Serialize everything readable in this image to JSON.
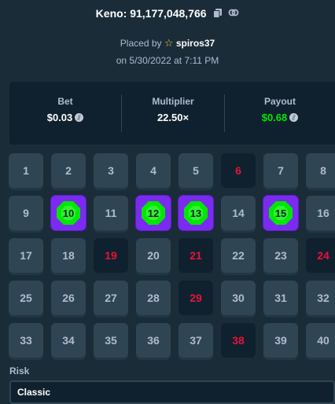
{
  "header": {
    "title": "Keno: 91,177,048,766",
    "placed_prefix": "Placed by",
    "username": "spiros37",
    "date": "on 5/30/2022 at 7:11 PM"
  },
  "stats": {
    "bet_label": "Bet",
    "bet_value": "$0.03",
    "multiplier_label": "Multiplier",
    "multiplier_value": "22.50×",
    "payout_label": "Payout",
    "payout_value": "$0.68"
  },
  "colors": {
    "background": "#1a2c38",
    "panel": "#0f212e",
    "tile": "#2f4553",
    "miss_text": "#e9113c",
    "hit_border": "#7b2bf0",
    "gem": "#00e701",
    "payout": "#00e701"
  },
  "tiles": [
    {
      "n": "1",
      "state": "normal"
    },
    {
      "n": "2",
      "state": "normal"
    },
    {
      "n": "3",
      "state": "normal"
    },
    {
      "n": "4",
      "state": "normal"
    },
    {
      "n": "5",
      "state": "normal"
    },
    {
      "n": "6",
      "state": "miss"
    },
    {
      "n": "7",
      "state": "normal"
    },
    {
      "n": "8",
      "state": "normal"
    },
    {
      "n": "9",
      "state": "normal"
    },
    {
      "n": "10",
      "state": "hit"
    },
    {
      "n": "11",
      "state": "normal"
    },
    {
      "n": "12",
      "state": "hit"
    },
    {
      "n": "13",
      "state": "hit"
    },
    {
      "n": "14",
      "state": "normal"
    },
    {
      "n": "15",
      "state": "hit"
    },
    {
      "n": "16",
      "state": "normal"
    },
    {
      "n": "17",
      "state": "normal"
    },
    {
      "n": "18",
      "state": "normal"
    },
    {
      "n": "19",
      "state": "miss"
    },
    {
      "n": "20",
      "state": "normal"
    },
    {
      "n": "21",
      "state": "miss"
    },
    {
      "n": "22",
      "state": "normal"
    },
    {
      "n": "23",
      "state": "normal"
    },
    {
      "n": "24",
      "state": "miss"
    },
    {
      "n": "25",
      "state": "normal"
    },
    {
      "n": "26",
      "state": "normal"
    },
    {
      "n": "27",
      "state": "normal"
    },
    {
      "n": "28",
      "state": "normal"
    },
    {
      "n": "29",
      "state": "miss"
    },
    {
      "n": "30",
      "state": "normal"
    },
    {
      "n": "31",
      "state": "normal"
    },
    {
      "n": "32",
      "state": "normal"
    },
    {
      "n": "33",
      "state": "normal"
    },
    {
      "n": "34",
      "state": "normal"
    },
    {
      "n": "35",
      "state": "normal"
    },
    {
      "n": "36",
      "state": "normal"
    },
    {
      "n": "37",
      "state": "normal"
    },
    {
      "n": "38",
      "state": "miss"
    },
    {
      "n": "39",
      "state": "normal"
    },
    {
      "n": "40",
      "state": "normal"
    }
  ],
  "risk": {
    "label": "Risk",
    "selected": "Classic"
  }
}
